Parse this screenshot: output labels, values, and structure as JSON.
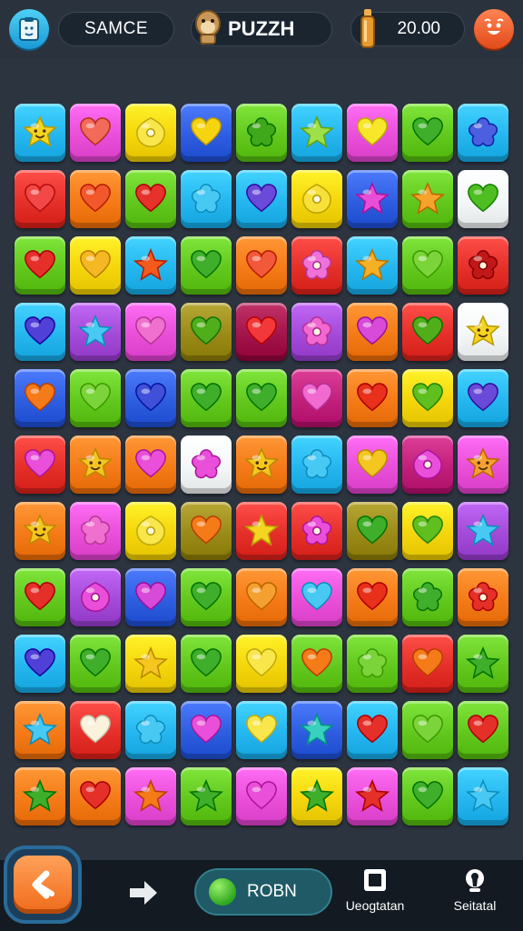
{
  "header": {
    "player_name": "SAMCE",
    "game_title": "PUZZH",
    "coins": "20.00",
    "menu_icon": "clipboard-face-icon",
    "title_icon": "monkey-icon",
    "coin_icon": "bottle-icon",
    "profile_icon": "smiley-face-icon"
  },
  "board": {
    "columns": 9,
    "rows": 11,
    "colors": {
      "y": "#f5d50c",
      "p": "#e94fd8",
      "b": "#2e5de0",
      "c": "#25b6f0",
      "g": "#62c81e",
      "r": "#e5302a",
      "o": "#f57a18",
      "w": "#f4f7f8",
      "v": "#a44ad8",
      "m": "#c0207a",
      "k": "#9a8a18",
      "d": "#a3154a"
    },
    "tiles": [
      [
        {
          "c": "c",
          "s": "star-face",
          "ic": "#f3d520",
          "face": true
        },
        {
          "c": "p",
          "s": "heart",
          "ic": "#f16a5a"
        },
        {
          "c": "y",
          "s": "drop",
          "ic": "#f8e64a",
          "dot": true
        },
        {
          "c": "b",
          "s": "heart",
          "ic": "#f6d410"
        },
        {
          "c": "g",
          "s": "flower",
          "ic": "#3fa81a"
        },
        {
          "c": "c",
          "s": "star",
          "ic": "#9ee04a"
        },
        {
          "c": "p",
          "s": "heart",
          "ic": "#f7e62a"
        },
        {
          "c": "g",
          "s": "heart",
          "ic": "#3fae2a"
        },
        {
          "c": "c",
          "s": "flower",
          "ic": "#4b5fe0"
        }
      ],
      [
        {
          "c": "r",
          "s": "heart",
          "ic": "#f24848"
        },
        {
          "c": "o",
          "s": "heart",
          "ic": "#f2582c"
        },
        {
          "c": "g",
          "s": "heart",
          "ic": "#e6322a"
        },
        {
          "c": "c",
          "s": "flower",
          "ic": "#47c9f4"
        },
        {
          "c": "c",
          "s": "heart",
          "ic": "#6a4ad8"
        },
        {
          "c": "y",
          "s": "drop",
          "ic": "#f7e03a",
          "dot": true
        },
        {
          "c": "b",
          "s": "star",
          "ic": "#e94ed8"
        },
        {
          "c": "g",
          "s": "star",
          "ic": "#f5a32a"
        },
        {
          "c": "w",
          "s": "heart",
          "ic": "#4fbe22"
        }
      ],
      [
        {
          "c": "g",
          "s": "heart",
          "ic": "#e5302a"
        },
        {
          "c": "y",
          "s": "heart",
          "ic": "#f5b823"
        },
        {
          "c": "c",
          "s": "star",
          "ic": "#f25a1e"
        },
        {
          "c": "g",
          "s": "heart",
          "ic": "#3fae2a"
        },
        {
          "c": "o",
          "s": "heart",
          "ic": "#f2583a"
        },
        {
          "c": "r",
          "s": "flower",
          "ic": "#f071d8",
          "dot": true
        },
        {
          "c": "c",
          "s": "star",
          "ic": "#f5b023"
        },
        {
          "c": "g",
          "s": "heart",
          "ic": "#7ad43a"
        },
        {
          "c": "r",
          "s": "flower",
          "ic": "#c01818",
          "dot": true
        }
      ],
      [
        {
          "c": "c",
          "s": "heart",
          "ic": "#5040d8"
        },
        {
          "c": "v",
          "s": "star",
          "ic": "#47c9f4"
        },
        {
          "c": "p",
          "s": "heart",
          "ic": "#f070d0"
        },
        {
          "c": "k",
          "s": "heart",
          "ic": "#4fae1a"
        },
        {
          "c": "d",
          "s": "heart",
          "ic": "#f2383a"
        },
        {
          "c": "v",
          "s": "flower",
          "ic": "#f068d0",
          "dot": true
        },
        {
          "c": "o",
          "s": "heart",
          "ic": "#d84ad8"
        },
        {
          "c": "r",
          "s": "heart",
          "ic": "#4fae1a"
        },
        {
          "c": "w",
          "s": "star-face",
          "ic": "#f5d520",
          "face": true
        }
      ],
      [
        {
          "c": "b",
          "s": "heart",
          "ic": "#f57a18"
        },
        {
          "c": "g",
          "s": "heart",
          "ic": "#7ad43a"
        },
        {
          "c": "b",
          "s": "heart",
          "ic": "#4050d8"
        },
        {
          "c": "g",
          "s": "heart",
          "ic": "#3fae2a"
        },
        {
          "c": "g",
          "s": "heart",
          "ic": "#3fae2a"
        },
        {
          "c": "m",
          "s": "heart",
          "ic": "#f06ad0"
        },
        {
          "c": "o",
          "s": "heart",
          "ic": "#e8301a"
        },
        {
          "c": "y",
          "s": "heart",
          "ic": "#5fbf1e"
        },
        {
          "c": "c",
          "s": "heart",
          "ic": "#6a4ad8"
        }
      ],
      [
        {
          "c": "r",
          "s": "heart",
          "ic": "#e94fd8"
        },
        {
          "c": "o",
          "s": "star-face",
          "ic": "#f5c520",
          "face": true
        },
        {
          "c": "o",
          "s": "heart",
          "ic": "#e94fd8"
        },
        {
          "c": "w",
          "s": "flower",
          "ic": "#e94fd8"
        },
        {
          "c": "o",
          "s": "star-face",
          "ic": "#f5c520",
          "face": true
        },
        {
          "c": "c",
          "s": "flower",
          "ic": "#47c9f4"
        },
        {
          "c": "p",
          "s": "heart",
          "ic": "#f5c520"
        },
        {
          "c": "m",
          "s": "drop",
          "ic": "#e94fd8",
          "dot": true
        },
        {
          "c": "p",
          "s": "star-face",
          "ic": "#f5a030",
          "face": true
        }
      ],
      [
        {
          "c": "o",
          "s": "star-face",
          "ic": "#f5c520",
          "face": true
        },
        {
          "c": "p",
          "s": "flower",
          "ic": "#f070d0"
        },
        {
          "c": "y",
          "s": "drop",
          "ic": "#f8e64a",
          "dot": true
        },
        {
          "c": "k",
          "s": "heart",
          "ic": "#f57a18"
        },
        {
          "c": "r",
          "s": "star",
          "ic": "#f5d520"
        },
        {
          "c": "r",
          "s": "flower",
          "ic": "#e94fd8",
          "dot": true
        },
        {
          "c": "k",
          "s": "heart",
          "ic": "#3fae2a"
        },
        {
          "c": "y",
          "s": "heart",
          "ic": "#5fbf1e"
        },
        {
          "c": "v",
          "s": "star",
          "ic": "#47c9f4"
        }
      ],
      [
        {
          "c": "g",
          "s": "heart",
          "ic": "#e5302a"
        },
        {
          "c": "v",
          "s": "drop",
          "ic": "#e94fd8",
          "dot": true
        },
        {
          "c": "b",
          "s": "heart",
          "ic": "#d84ad8"
        },
        {
          "c": "g",
          "s": "heart",
          "ic": "#3fae2a"
        },
        {
          "c": "o",
          "s": "heart",
          "ic": "#f5a030"
        },
        {
          "c": "p",
          "s": "heart",
          "ic": "#47c9f4"
        },
        {
          "c": "o",
          "s": "heart",
          "ic": "#e8301a"
        },
        {
          "c": "g",
          "s": "flower",
          "ic": "#3fae2a"
        },
        {
          "c": "o",
          "s": "flower",
          "ic": "#e5302a",
          "dot": true
        }
      ],
      [
        {
          "c": "c",
          "s": "heart",
          "ic": "#5040d8"
        },
        {
          "c": "g",
          "s": "heart",
          "ic": "#3fae2a"
        },
        {
          "c": "y",
          "s": "star",
          "ic": "#f5c520"
        },
        {
          "c": "g",
          "s": "heart",
          "ic": "#3fae2a"
        },
        {
          "c": "y",
          "s": "heart",
          "ic": "#f8e64a"
        },
        {
          "c": "g",
          "s": "heart",
          "ic": "#f57a18"
        },
        {
          "c": "g",
          "s": "flower",
          "ic": "#7ad43a"
        },
        {
          "c": "r",
          "s": "heart",
          "ic": "#f57a18"
        },
        {
          "c": "g",
          "s": "star",
          "ic": "#3fae2a"
        }
      ],
      [
        {
          "c": "o",
          "s": "star",
          "ic": "#47c9f4"
        },
        {
          "c": "r",
          "s": "heart",
          "ic": "#fbf2dc"
        },
        {
          "c": "c",
          "s": "flower",
          "ic": "#47c9f4"
        },
        {
          "c": "b",
          "s": "heart",
          "ic": "#e94fd8"
        },
        {
          "c": "c",
          "s": "heart",
          "ic": "#f8e64a"
        },
        {
          "c": "b",
          "s": "star",
          "ic": "#3ad0c0"
        },
        {
          "c": "c",
          "s": "heart",
          "ic": "#e5302a"
        },
        {
          "c": "g",
          "s": "heart",
          "ic": "#7ad43a"
        },
        {
          "c": "g",
          "s": "heart",
          "ic": "#e5302a"
        }
      ],
      [
        {
          "c": "o",
          "s": "star",
          "ic": "#3fae2a"
        },
        {
          "c": "o",
          "s": "heart",
          "ic": "#e5302a"
        },
        {
          "c": "p",
          "s": "star",
          "ic": "#f57a18"
        },
        {
          "c": "g",
          "s": "star",
          "ic": "#3fae2a"
        },
        {
          "c": "p",
          "s": "heart",
          "ic": "#e94fd8"
        },
        {
          "c": "y",
          "s": "star",
          "ic": "#3fae2a"
        },
        {
          "c": "p",
          "s": "star",
          "ic": "#e5302a"
        },
        {
          "c": "g",
          "s": "heart",
          "ic": "#3fae2a"
        },
        {
          "c": "c",
          "s": "star",
          "ic": "#47c9f4"
        }
      ]
    ]
  },
  "footer": {
    "back_icon": "back-arrow-icon",
    "arrow_icon": "right-arrow-icon",
    "run_label": "ROBN",
    "tool1_label": "Ueogtatan",
    "tool1_icon": "square-frame-icon",
    "tool2_label": "Seitatal",
    "tool2_icon": "keyhole-icon"
  }
}
